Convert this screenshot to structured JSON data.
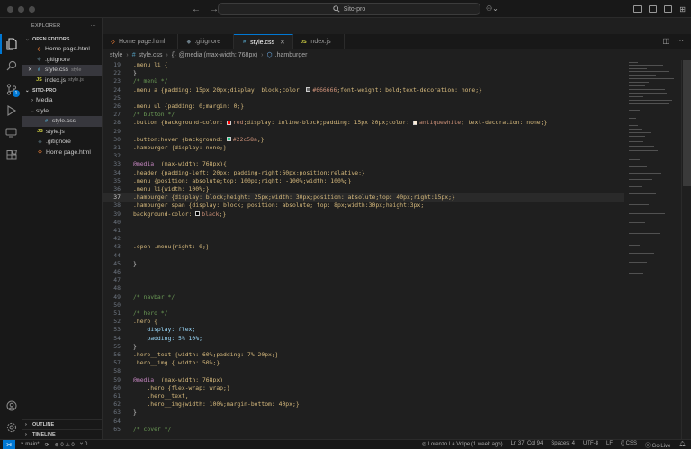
{
  "window": {
    "title": "Sito-pro"
  },
  "activity": {
    "scm_badge": "1"
  },
  "explorer": {
    "title": "EXPLORER",
    "more": "···",
    "open_editors_label": "OPEN EDITORS",
    "open_editors": [
      {
        "name": "Home page.html",
        "icon": "html-file-icon",
        "icon_text": "◇",
        "icon_color": "#e37933",
        "hint": "",
        "close": ""
      },
      {
        "name": ".gitignore",
        "icon": "git-file-icon",
        "icon_text": "◆",
        "icon_color": "#41535b",
        "hint": "",
        "close": ""
      },
      {
        "name": "style.css",
        "icon": "css-file-icon",
        "icon_text": "#",
        "icon_color": "#519aba",
        "hint": "style",
        "close": "✕",
        "selected": true
      },
      {
        "name": "index.js",
        "icon": "js-file-icon",
        "icon_text": "JS",
        "icon_color": "#cbcb41",
        "hint": "style.js",
        "close": ""
      }
    ],
    "project_label": "SITO-PRO",
    "tree": [
      {
        "name": "Media",
        "indent": 1,
        "chev": "›",
        "icon": "",
        "icon_text": "",
        "icon_color": ""
      },
      {
        "name": "style",
        "indent": 1,
        "chev": "⌄",
        "icon": "",
        "icon_text": "",
        "icon_color": ""
      },
      {
        "name": "style.css",
        "indent": 2,
        "chev": "",
        "icon": "css-file-icon",
        "icon_text": "#",
        "icon_color": "#519aba",
        "selected": true
      },
      {
        "name": "style.js",
        "indent": 1,
        "chev": "",
        "icon": "js-file-icon",
        "icon_text": "JS",
        "icon_color": "#cbcb41"
      },
      {
        "name": ".gitignore",
        "indent": 1,
        "chev": "",
        "icon": "git-file-icon",
        "icon_text": "◆",
        "icon_color": "#41535b"
      },
      {
        "name": "Home page.html",
        "indent": 1,
        "chev": "",
        "icon": "html-file-icon",
        "icon_text": "◇",
        "icon_color": "#e37933"
      }
    ],
    "outline_label": "OUTLINE",
    "timeline_label": "TIMELINE"
  },
  "tabs": [
    {
      "label": "Home page.html",
      "icon_text": "◇",
      "icon_color": "#e37933",
      "active": false,
      "close": ""
    },
    {
      "label": ".gitignore",
      "icon_text": "◆",
      "icon_color": "#6a7b85",
      "active": false,
      "close": ""
    },
    {
      "label": "style.css",
      "icon_text": "#",
      "icon_color": "#519aba",
      "active": true,
      "close": "✕"
    },
    {
      "label": "index.js",
      "icon_text": "JS",
      "icon_color": "#cbcb41",
      "active": false,
      "close": ""
    }
  ],
  "breadcrumb": {
    "folder": "style",
    "file": "style.css",
    "media": "@media (max-width: 768px)",
    "selector": ".hamburger"
  },
  "editor": {
    "current_line": 37,
    "lines": [
      {
        "n": 19,
        "t": [
          [
            ".menu li {",
            "#d7ba7d"
          ]
        ]
      },
      {
        "n": 22,
        "t": [
          [
            "}",
            "#d4d4d4"
          ]
        ]
      },
      {
        "n": 23,
        "t": [
          [
            "/* menù */",
            "#6a9955"
          ]
        ]
      },
      {
        "n": 24,
        "t": [
          [
            ".menu a {padding: 15px 20px;display: block;color: ",
            "#d7ba7d"
          ],
          [
            "#666666",
            "#ce9178",
            "#666666"
          ],
          [
            ";font-weight: bold;text-decoration: none;}",
            "#d7ba7d"
          ]
        ]
      },
      {
        "n": 25,
        "t": []
      },
      {
        "n": 26,
        "t": [
          [
            ".menu ul {padding: 0;margin: 0;}",
            "#d7ba7d"
          ]
        ]
      },
      {
        "n": 27,
        "t": [
          [
            "/* button */",
            "#6a9955"
          ]
        ]
      },
      {
        "n": 28,
        "t": [
          [
            ".button {background-color: ",
            "#d7ba7d"
          ],
          [
            "red",
            "#ce9178",
            "#ff0000"
          ],
          [
            ";display: inline-block;padding: 15px 20px;color: ",
            "#d7ba7d"
          ],
          [
            "antiquewhite",
            "#ce9178",
            "#faebd7"
          ],
          [
            "; text-decoration: none;}",
            "#d7ba7d"
          ]
        ]
      },
      {
        "n": 29,
        "t": []
      },
      {
        "n": 30,
        "t": [
          [
            ".button:hover {background: ",
            "#d7ba7d"
          ],
          [
            "#22c58a",
            "#ce9178",
            "#22c58a"
          ],
          [
            ";}",
            "#d7ba7d"
          ]
        ]
      },
      {
        "n": 31,
        "t": [
          [
            ".hamburger {display: none;}",
            "#d7ba7d"
          ]
        ]
      },
      {
        "n": 32,
        "t": []
      },
      {
        "n": 33,
        "t": [
          [
            "@media",
            "#c586c0"
          ],
          [
            "  (max-width: 768px){",
            "#d7ba7d"
          ]
        ]
      },
      {
        "n": 34,
        "t": [
          [
            ".header {padding-left: 20px; padding-right:60px;position:relative;}",
            "#d7ba7d"
          ]
        ]
      },
      {
        "n": 35,
        "t": [
          [
            ".menu {position: absolute;top: 100px;right: -100%;width: 100%;}",
            "#d7ba7d"
          ]
        ]
      },
      {
        "n": 36,
        "t": [
          [
            ".menu li{width: 100%;}",
            "#d7ba7d"
          ]
        ]
      },
      {
        "n": 37,
        "t": [
          [
            ".hamburger {display: block;height: 25px;width: 30px;position: absolute;top: 40px;right:15px;}",
            "#d7ba7d"
          ]
        ]
      },
      {
        "n": 38,
        "t": [
          [
            ".hamburger span {display: block; position: absolute; top: 8px;width:30px;height:3px;",
            "#d7ba7d"
          ]
        ]
      },
      {
        "n": 39,
        "t": [
          [
            "background-color: ",
            "#d7ba7d"
          ],
          [
            "black",
            "#ce9178",
            "#000000"
          ],
          [
            ";}",
            "#d7ba7d"
          ]
        ]
      },
      {
        "n": 40,
        "t": []
      },
      {
        "n": 41,
        "t": []
      },
      {
        "n": 42,
        "t": []
      },
      {
        "n": 43,
        "t": [
          [
            ".open .menu{right: 0;}",
            "#d7ba7d"
          ]
        ]
      },
      {
        "n": 44,
        "t": []
      },
      {
        "n": 45,
        "t": [
          [
            "}",
            "#d4d4d4"
          ]
        ]
      },
      {
        "n": 46,
        "t": []
      },
      {
        "n": 47,
        "t": []
      },
      {
        "n": 48,
        "t": []
      },
      {
        "n": 49,
        "t": [
          [
            "/* navbar */",
            "#6a9955"
          ]
        ]
      },
      {
        "n": 50,
        "t": []
      },
      {
        "n": 51,
        "t": [
          [
            "/* hero */",
            "#6a9955"
          ]
        ]
      },
      {
        "n": 52,
        "t": [
          [
            ".hero {",
            "#d7ba7d"
          ]
        ]
      },
      {
        "n": 53,
        "t": [
          [
            "    display: flex;",
            "#9cdcfe"
          ]
        ]
      },
      {
        "n": 54,
        "t": [
          [
            "    padding: 5% 10%;",
            "#9cdcfe"
          ]
        ]
      },
      {
        "n": 55,
        "t": [
          [
            "}",
            "#d4d4d4"
          ]
        ]
      },
      {
        "n": 56,
        "t": [
          [
            ".hero__text {width: 60%;padding: 7% 20px;}",
            "#d7ba7d"
          ]
        ]
      },
      {
        "n": 57,
        "t": [
          [
            ".hero__img { width: 50%;}",
            "#d7ba7d"
          ]
        ]
      },
      {
        "n": 58,
        "t": []
      },
      {
        "n": 59,
        "t": [
          [
            "@media",
            "#c586c0"
          ],
          [
            "  (max-width: 768px)",
            "#d7ba7d"
          ]
        ]
      },
      {
        "n": 60,
        "t": [
          [
            "    .hero {flex-wrap: wrap;}",
            "#d7ba7d"
          ]
        ]
      },
      {
        "n": 61,
        "t": [
          [
            "    .hero__text,",
            "#d7ba7d"
          ]
        ]
      },
      {
        "n": 62,
        "t": [
          [
            "    .hero__img{width: 100%;margin-bottom: 40px;}",
            "#d7ba7d"
          ]
        ]
      },
      {
        "n": 63,
        "t": [
          [
            "}",
            "#d4d4d4"
          ]
        ]
      },
      {
        "n": 64,
        "t": []
      },
      {
        "n": 65,
        "t": [
          [
            "/* cover */",
            "#6a9955"
          ]
        ]
      }
    ]
  },
  "status": {
    "branch": "main*",
    "sync": "⟳",
    "problems": "⊗ 0 ⚠ 0",
    "ports": "⑂ 0",
    "blame": "Lorenzo La Volpe (1 week ago)",
    "position": "Ln 37, Col 94",
    "spaces": "Spaces: 4",
    "encoding": "UTF-8",
    "eol": "LF",
    "language": "{} CSS",
    "golive": "⦿ Go Live"
  }
}
